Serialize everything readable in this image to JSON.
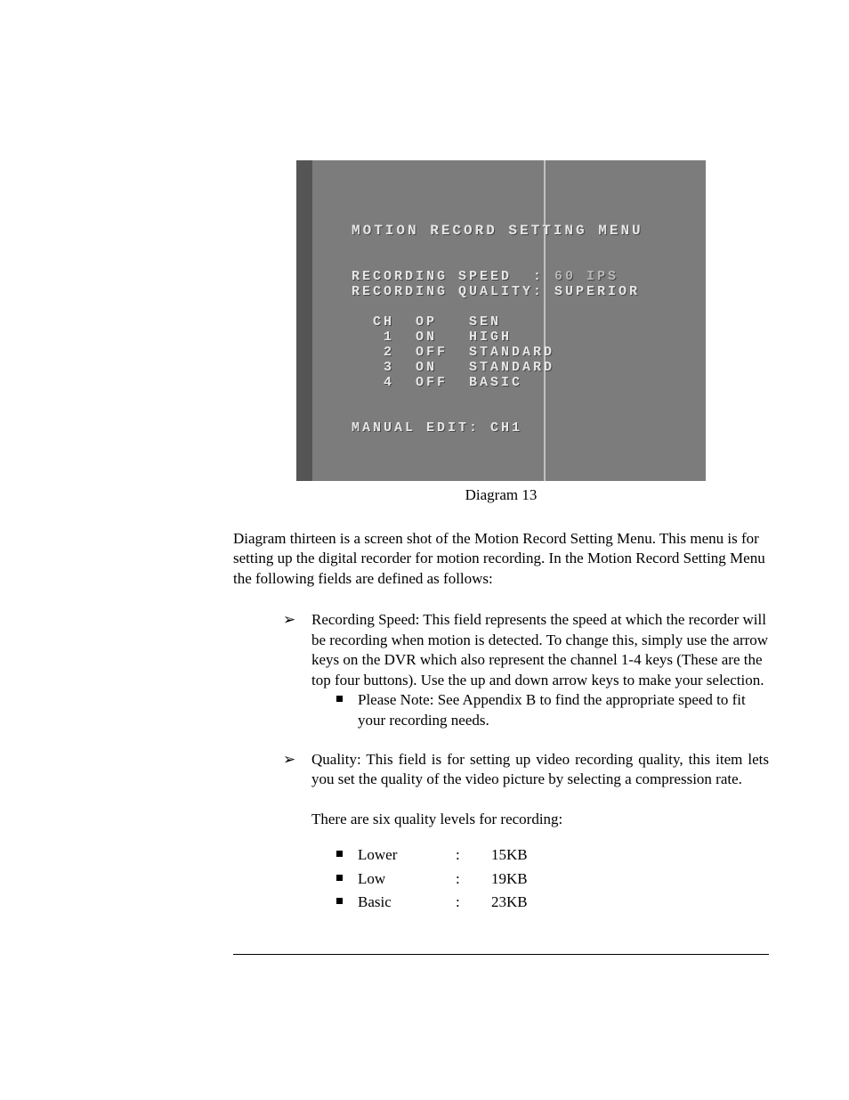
{
  "screenshot": {
    "title": "MOTION RECORD SETTING MENU",
    "line_speed_label": "RECORDING SPEED  :",
    "line_speed_value": " 60 IPS",
    "line_quality_label": "RECORDING QUALITY:",
    "line_quality_value": " SUPERIOR",
    "table_header": "  CH  OP   SEN",
    "rows": [
      "   1  ON   HIGH",
      "   2  OFF  STANDARD",
      "   3  ON   STANDARD",
      "   4  OFF  BASIC"
    ],
    "manual_edit": "MANUAL EDIT: CH1"
  },
  "caption": "Diagram 13",
  "intro_para": "Diagram thirteen is a screen shot of the Motion Record Setting Menu. This menu is for setting up the digital recorder for motion recording. In the Motion Record Setting Menu the following fields are defined as follows:",
  "bullets": {
    "recording_speed": "Recording Speed: This field represents the speed at which the recorder will be recording when motion is detected. To change this, simply use the arrow keys on the DVR which also represent the channel 1-4 keys (These are the top four buttons). Use the up and down arrow keys to make your selection.",
    "note": "Please Note: See Appendix B to find the appropriate speed to fit your recording needs.",
    "quality": "Quality: This field is for setting up video recording quality, this item lets you set the quality of the video picture by selecting a compression rate.",
    "quality_intro": "There are six quality levels for recording:",
    "levels": [
      {
        "name": "Lower",
        "colon": ":",
        "size": "15KB"
      },
      {
        "name": "Low",
        "colon": ":",
        "size": "19KB"
      },
      {
        "name": "Basic",
        "colon": ":",
        "size": "23KB"
      }
    ]
  }
}
